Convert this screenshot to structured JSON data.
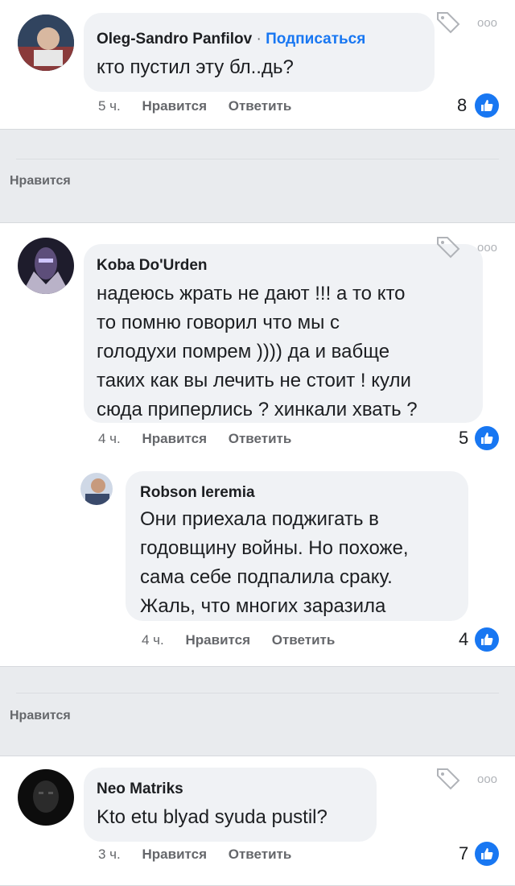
{
  "comments": [
    {
      "author": "Oleg-Sandro Panfilov",
      "separator": "·",
      "subscribe": "Подписаться",
      "text": "кто пустил эту бл..дь?",
      "time": "5 ч.",
      "like": "Нравится",
      "reply": "Ответить",
      "reactions": "8"
    },
    {
      "author": "Koba Do'Urden",
      "lines": [
        "надеюсь жрать не дают !!! а то кто",
        "то помню говорил что мы с",
        "голодухи помрем )))) да и вабще",
        "таких как вы лечить не стоит ! кули",
        "сюда приперлись ? хинкали хвать ?"
      ],
      "time": "4 ч.",
      "like": "Нравится",
      "reply": "Ответить",
      "reactions": "5"
    },
    {
      "author": "Robson Ieremia",
      "lines": [
        "Они приехала поджигать в",
        "годовщину войны. Но похоже,",
        "сама себе подпалила сраку.",
        "Жаль, что многих заразила"
      ],
      "time": "4 ч.",
      "like": "Нравится",
      "reply": "Ответить",
      "reactions": "4"
    },
    {
      "author": "Neo Matriks",
      "text": "Kto etu blyad syuda pustil?",
      "time": "3 ч.",
      "like": "Нравится",
      "reply": "Ответить",
      "reactions": "7"
    }
  ],
  "likebar_1": "Нравится",
  "likebar_2": "Нравится",
  "more_glyph": "ooo",
  "icons": {
    "like": "thumbs-up-icon",
    "tag": "tag-icon",
    "more": "more-icon"
  },
  "colors": {
    "accent": "#1877f2",
    "bubble": "#f0f2f5",
    "background": "#e9ebee"
  }
}
